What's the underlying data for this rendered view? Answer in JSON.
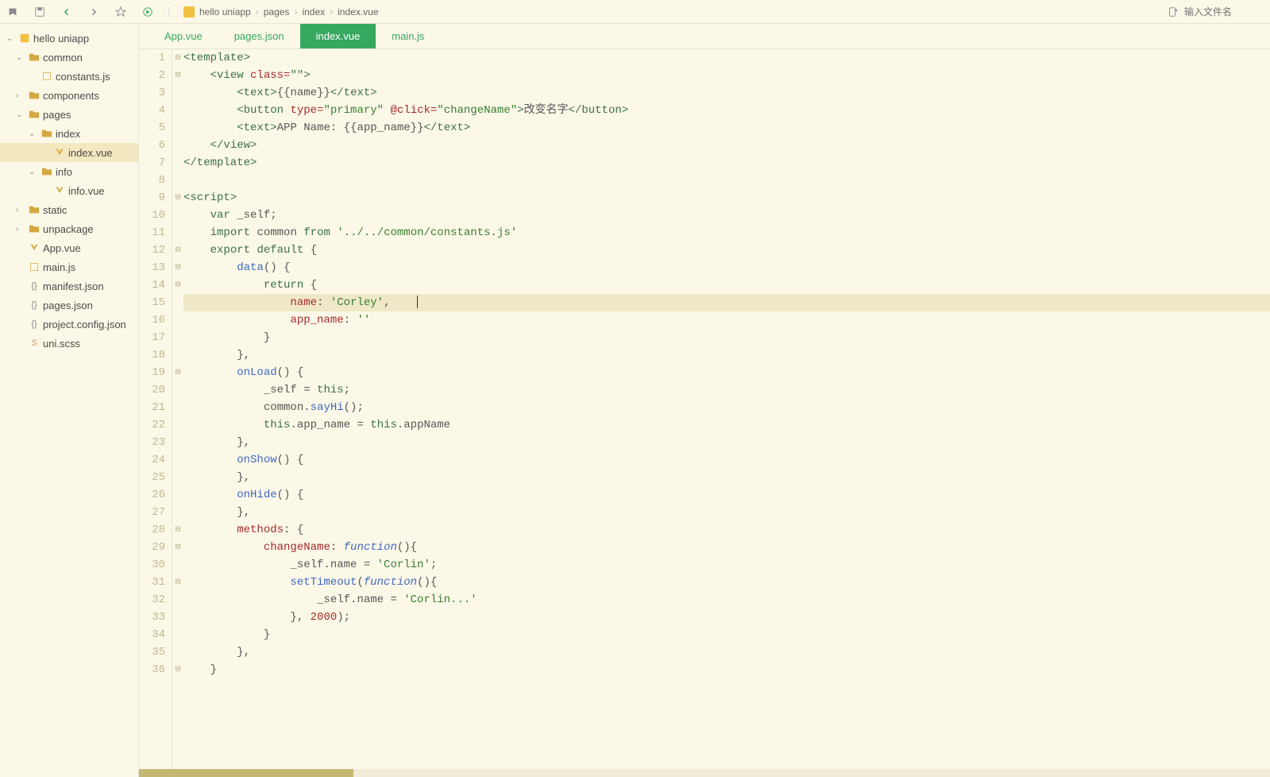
{
  "toolbar": {
    "search_placeholder": "输入文件名"
  },
  "breadcrumb": [
    "hello uniapp",
    "pages",
    "index",
    "index.vue"
  ],
  "sidebar": {
    "items": [
      {
        "label": "hello uniapp",
        "type": "project",
        "depth": 0,
        "expanded": true
      },
      {
        "label": "common",
        "type": "folder",
        "depth": 1,
        "expanded": true
      },
      {
        "label": "constants.js",
        "type": "js",
        "depth": 2
      },
      {
        "label": "components",
        "type": "folder",
        "depth": 1,
        "expanded": false
      },
      {
        "label": "pages",
        "type": "folder",
        "depth": 1,
        "expanded": true
      },
      {
        "label": "index",
        "type": "folder",
        "depth": 2,
        "expanded": true
      },
      {
        "label": "index.vue",
        "type": "vue",
        "depth": 3,
        "selected": true
      },
      {
        "label": "info",
        "type": "folder",
        "depth": 2,
        "expanded": true
      },
      {
        "label": "info.vue",
        "type": "vue",
        "depth": 3
      },
      {
        "label": "static",
        "type": "folder",
        "depth": 1,
        "expanded": false
      },
      {
        "label": "unpackage",
        "type": "folder",
        "depth": 1,
        "expanded": false
      },
      {
        "label": "App.vue",
        "type": "vue",
        "depth": 1
      },
      {
        "label": "main.js",
        "type": "js",
        "depth": 1
      },
      {
        "label": "manifest.json",
        "type": "json",
        "depth": 1
      },
      {
        "label": "pages.json",
        "type": "json",
        "depth": 1
      },
      {
        "label": "project.config.json",
        "type": "json",
        "depth": 1
      },
      {
        "label": "uni.scss",
        "type": "scss",
        "depth": 1
      }
    ]
  },
  "tabs": [
    {
      "label": "App.vue",
      "active": false
    },
    {
      "label": "pages.json",
      "active": false
    },
    {
      "label": "index.vue",
      "active": true
    },
    {
      "label": "main.js",
      "active": false
    }
  ],
  "code": {
    "lines": [
      {
        "n": 1,
        "fold": "⊟",
        "html": "<span class='tk-tag'>&lt;template&gt;</span>"
      },
      {
        "n": 2,
        "fold": "⊟",
        "html": "    <span class='tk-tag'>&lt;view </span><span class='tk-attr'>class=</span><span class='tk-str'>\"\"</span><span class='tk-tag'>&gt;</span>"
      },
      {
        "n": 3,
        "fold": "",
        "html": "        <span class='tk-tag'>&lt;text&gt;</span><span class='tk-plain'>{{name}}</span><span class='tk-tag'>&lt;/text&gt;</span>"
      },
      {
        "n": 4,
        "fold": "",
        "html": "        <span class='tk-tag'>&lt;button </span><span class='tk-attr'>type=</span><span class='tk-str'>\"primary\"</span> <span class='tk-attr'>@click=</span><span class='tk-str'>\"changeName\"</span><span class='tk-tag'>&gt;</span><span class='tk-plain'>改变名字</span><span class='tk-tag'>&lt;/button&gt;</span>"
      },
      {
        "n": 5,
        "fold": "",
        "html": "        <span class='tk-tag'>&lt;text&gt;</span><span class='tk-plain'>APP Name: {{app_name}}</span><span class='tk-tag'>&lt;/text&gt;</span>"
      },
      {
        "n": 6,
        "fold": "",
        "html": "    <span class='tk-tag'>&lt;/view&gt;</span>"
      },
      {
        "n": 7,
        "fold": "",
        "html": "<span class='tk-tag'>&lt;/template&gt;</span>"
      },
      {
        "n": 8,
        "fold": "",
        "html": ""
      },
      {
        "n": 9,
        "fold": "⊟",
        "html": "<span class='tk-tag'>&lt;script&gt;</span>"
      },
      {
        "n": 10,
        "fold": "",
        "html": "    <span class='tk-kw'>var</span> <span class='tk-plain'>_self;</span>"
      },
      {
        "n": 11,
        "fold": "",
        "html": "    <span class='tk-kw'>import</span> <span class='tk-plain'>common</span> <span class='tk-kw'>from</span> <span class='tk-str'>'../../common/constants.js'</span>"
      },
      {
        "n": 12,
        "fold": "⊟",
        "html": "    <span class='tk-kw'>export</span> <span class='tk-kw'>default</span> <span class='tk-plain'>{</span>"
      },
      {
        "n": 13,
        "fold": "⊟",
        "html": "        <span class='tk-builtin'>data</span><span class='tk-plain'>() {</span>"
      },
      {
        "n": 14,
        "fold": "⊟",
        "html": "            <span class='tk-kw'>return</span> <span class='tk-plain'>{</span>"
      },
      {
        "n": 15,
        "fold": "",
        "highlighted": true,
        "html": "                <span class='tk-prop'>name</span><span class='tk-plain'>: </span><span class='tk-str'>'Corley'</span><span class='tk-plain'>,</span>    <span class='cursor'></span>"
      },
      {
        "n": 16,
        "fold": "",
        "html": "                <span class='tk-prop'>app_name</span><span class='tk-plain'>: </span><span class='tk-str'>''</span>"
      },
      {
        "n": 17,
        "fold": "",
        "html": "            <span class='tk-plain'>}</span>"
      },
      {
        "n": 18,
        "fold": "",
        "html": "        <span class='tk-plain'>},</span>"
      },
      {
        "n": 19,
        "fold": "⊟",
        "html": "        <span class='tk-builtin'>onLoad</span><span class='tk-plain'>() {</span>"
      },
      {
        "n": 20,
        "fold": "",
        "html": "            <span class='tk-plain'>_self = </span><span class='tk-this'>this</span><span class='tk-plain'>;</span>"
      },
      {
        "n": 21,
        "fold": "",
        "html": "            <span class='tk-plain'>common.</span><span class='tk-builtin'>sayHi</span><span class='tk-plain'>();</span>"
      },
      {
        "n": 22,
        "fold": "",
        "html": "            <span class='tk-this'>this</span><span class='tk-plain'>.app_name = </span><span class='tk-this'>this</span><span class='tk-plain'>.appName</span>"
      },
      {
        "n": 23,
        "fold": "",
        "html": "        <span class='tk-plain'>},</span>"
      },
      {
        "n": 24,
        "fold": "",
        "html": "        <span class='tk-builtin'>onShow</span><span class='tk-plain'>() {</span>"
      },
      {
        "n": 25,
        "fold": "",
        "html": "        <span class='tk-plain'>},</span>"
      },
      {
        "n": 26,
        "fold": "",
        "html": "        <span class='tk-builtin'>onHide</span><span class='tk-plain'>() {</span>"
      },
      {
        "n": 27,
        "fold": "",
        "html": "        <span class='tk-plain'>},</span>"
      },
      {
        "n": 28,
        "fold": "⊟",
        "html": "        <span class='tk-prop'>methods</span><span class='tk-plain'>: {</span>"
      },
      {
        "n": 29,
        "fold": "⊟",
        "html": "            <span class='tk-prop'>changeName</span><span class='tk-plain'>: </span><span class='tk-func'>function</span><span class='tk-plain'>(){</span>"
      },
      {
        "n": 30,
        "fold": "",
        "html": "                <span class='tk-plain'>_self.name = </span><span class='tk-str'>'Corlin'</span><span class='tk-plain'>;</span>"
      },
      {
        "n": 31,
        "fold": "⊟",
        "html": "                <span class='tk-builtin'>setTimeout</span><span class='tk-plain'>(</span><span class='tk-func'>function</span><span class='tk-plain'>(){</span>"
      },
      {
        "n": 32,
        "fold": "",
        "html": "                    <span class='tk-plain'>_self.name = </span><span class='tk-str'>'Corlin...'</span>"
      },
      {
        "n": 33,
        "fold": "",
        "html": "                <span class='tk-plain'>}, </span><span class='tk-num'>2000</span><span class='tk-plain'>);</span>"
      },
      {
        "n": 34,
        "fold": "",
        "html": "            <span class='tk-plain'>}</span>"
      },
      {
        "n": 35,
        "fold": "",
        "html": "        <span class='tk-plain'>},</span>"
      },
      {
        "n": 36,
        "fold": "⊟",
        "html": "    <span class='tk-plain'>}</span>"
      }
    ]
  }
}
